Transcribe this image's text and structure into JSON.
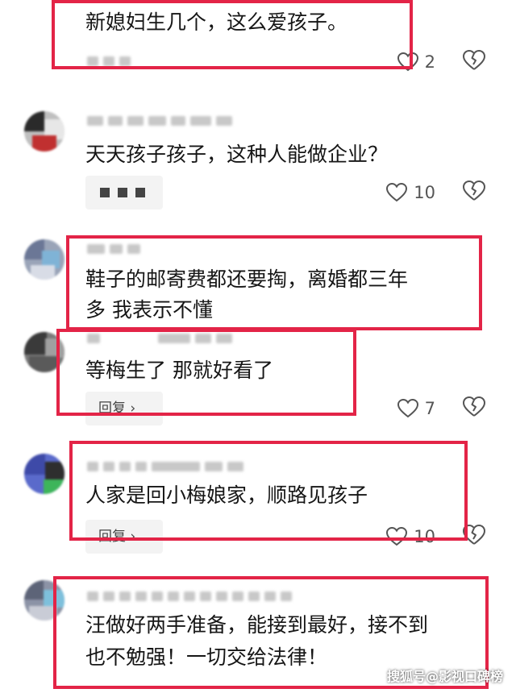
{
  "comments": [
    {
      "text": "新媳妇生几个，这么爱孩子。",
      "likes": "2"
    },
    {
      "text": "天天孩子孩子，这种人能做企业？",
      "likes": "10"
    },
    {
      "line1": "鞋子的邮寄费都还要掏，离婚都三年",
      "line2": "多 我表示不懂"
    },
    {
      "text": "等梅生了 那就好看了",
      "reply": "回复 ›",
      "likes": "7"
    },
    {
      "text": "人家是回小梅娘家，顺路见孩子",
      "reply": "回复 ›",
      "likes": "10"
    },
    {
      "line1": "汪做好两手准备，能接到最好，接不到",
      "line2": "也不勉强！一切交给法律！"
    }
  ],
  "watermark": "搜狐号@影视口碑榜",
  "colors": {
    "highlight": "#e32447",
    "reply_bg": "#f3f3f3"
  },
  "icons": {
    "like": "heart-outline-icon",
    "dislike": "broken-heart-icon"
  }
}
